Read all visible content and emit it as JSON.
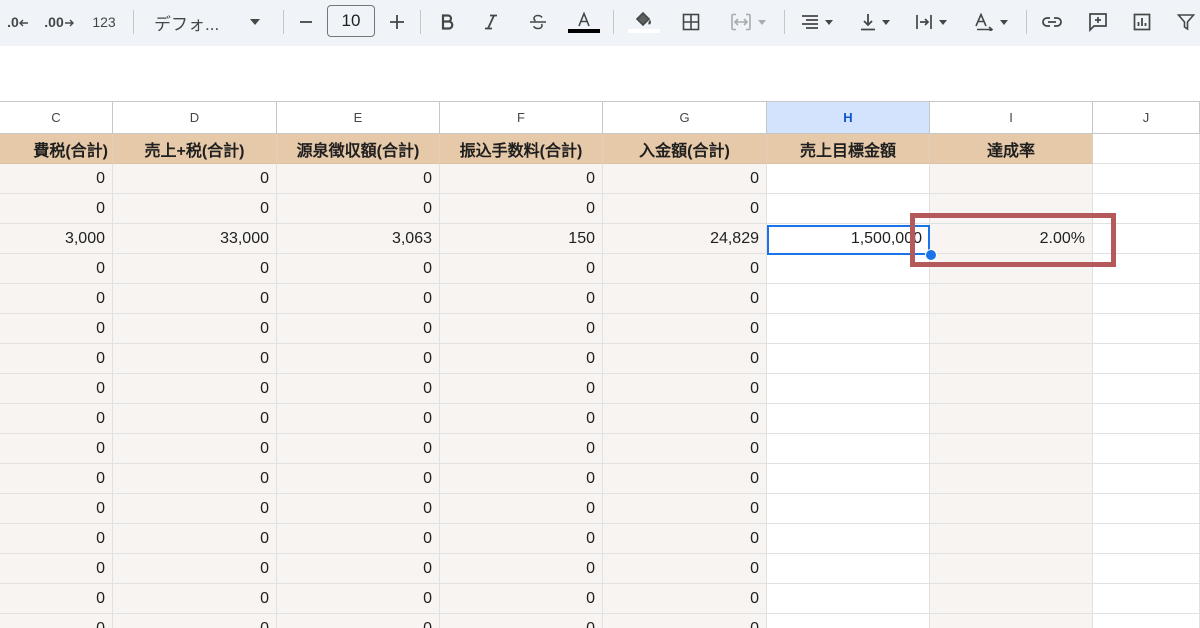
{
  "toolbar": {
    "decimal_decrease": ".0",
    "decimal_increase": ".00",
    "number_format": "123",
    "font_name": "デフォ...",
    "font_size": "10",
    "colors": {
      "toolbar_bg": "#f0f4f9",
      "text_color_bar": "#000000",
      "accent": "#1a73e8"
    }
  },
  "columns": [
    {
      "letter": "C",
      "header": "費税(合計)",
      "selected": false
    },
    {
      "letter": "D",
      "header": "売上+税(合計)",
      "selected": false
    },
    {
      "letter": "E",
      "header": "源泉徴収額(合計)",
      "selected": false
    },
    {
      "letter": "F",
      "header": "振込手数料(合計)",
      "selected": false
    },
    {
      "letter": "G",
      "header": "入金額(合計)",
      "selected": false
    },
    {
      "letter": "H",
      "header": "売上目標金額",
      "selected": true
    },
    {
      "letter": "I",
      "header": "達成率",
      "selected": false
    },
    {
      "letter": "J",
      "header": "",
      "selected": false
    }
  ],
  "rows": [
    [
      "0",
      "0",
      "0",
      "0",
      "0",
      "",
      ""
    ],
    [
      "0",
      "0",
      "0",
      "0",
      "0",
      "",
      ""
    ],
    [
      "3,000",
      "33,000",
      "3,063",
      "150",
      "24,829",
      "1,500,000",
      "2.00%"
    ],
    [
      "0",
      "0",
      "0",
      "0",
      "0",
      "",
      ""
    ],
    [
      "0",
      "0",
      "0",
      "0",
      "0",
      "",
      ""
    ],
    [
      "0",
      "0",
      "0",
      "0",
      "0",
      "",
      ""
    ],
    [
      "0",
      "0",
      "0",
      "0",
      "0",
      "",
      ""
    ],
    [
      "0",
      "0",
      "0",
      "0",
      "0",
      "",
      ""
    ],
    [
      "0",
      "0",
      "0",
      "0",
      "0",
      "",
      ""
    ],
    [
      "0",
      "0",
      "0",
      "0",
      "0",
      "",
      ""
    ],
    [
      "0",
      "0",
      "0",
      "0",
      "0",
      "",
      ""
    ],
    [
      "0",
      "0",
      "0",
      "0",
      "0",
      "",
      ""
    ],
    [
      "0",
      "0",
      "0",
      "0",
      "0",
      "",
      ""
    ],
    [
      "0",
      "0",
      "0",
      "0",
      "0",
      "",
      ""
    ],
    [
      "0",
      "0",
      "0",
      "0",
      "0",
      "",
      ""
    ],
    [
      "0",
      "0",
      "0",
      "0",
      "0",
      "",
      ""
    ]
  ],
  "colors": {
    "header_fill": "#e6c9a8",
    "band_fill": "#f8f4f1",
    "selection": "#1a73e8",
    "highlight": "#b45a5a"
  }
}
